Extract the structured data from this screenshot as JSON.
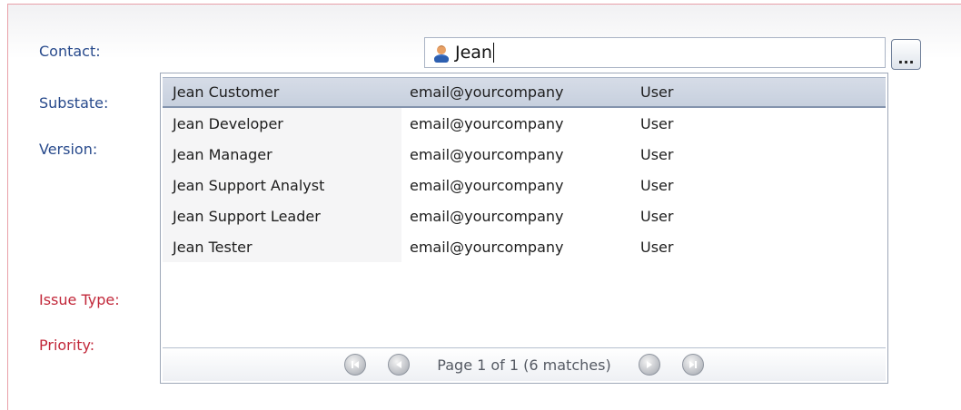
{
  "form": {
    "labels": {
      "contact": "Contact:",
      "substate": "Substate:",
      "version": "Version:",
      "issue_type": "Issue Type:",
      "priority": "Priority:"
    },
    "contact_value": "Jean",
    "ellipsis_label": "..."
  },
  "dropdown": {
    "rows": [
      {
        "name": "Jean Customer",
        "email": "email@yourcompany",
        "type": "User"
      },
      {
        "name": "Jean Developer",
        "email": "email@yourcompany",
        "type": "User"
      },
      {
        "name": "Jean Manager",
        "email": "email@yourcompany",
        "type": "User"
      },
      {
        "name": "Jean Support Analyst",
        "email": "email@yourcompany",
        "type": "User"
      },
      {
        "name": "Jean Support Leader",
        "email": "email@yourcompany",
        "type": "User"
      },
      {
        "name": "Jean Tester",
        "email": "email@yourcompany",
        "type": "User"
      }
    ],
    "selected_index": 0,
    "pager_text": "Page 1 of 1 (6 matches)",
    "pager_icons": [
      "first-page-icon",
      "previous-page-icon",
      "next-page-icon",
      "last-page-icon"
    ]
  },
  "colors": {
    "label": "#284a8c",
    "required_label": "#c2283a",
    "selected_row": "#cbd3e1"
  }
}
